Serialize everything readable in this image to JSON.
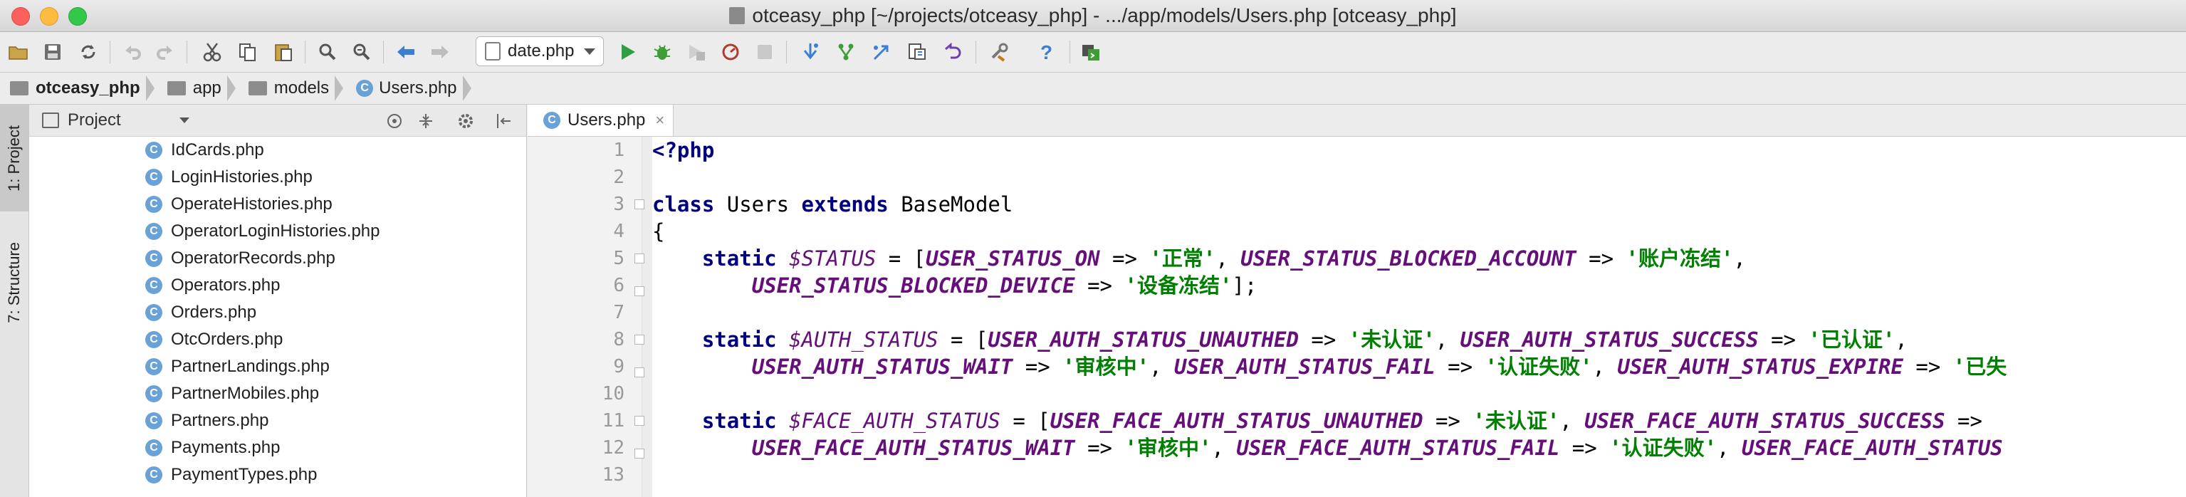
{
  "window": {
    "title": "otceasy_php [~/projects/otceasy_php] - .../app/models/Users.php [otceasy_php]"
  },
  "toolbar": {
    "run_config": "date.php",
    "icons": [
      "open-folder-icon",
      "save-icon",
      "sync-icon",
      "undo-icon",
      "redo-icon",
      "cut-icon",
      "copy-icon",
      "paste-icon",
      "find-icon",
      "replace-icon",
      "back-icon",
      "forward-icon",
      "run-icon",
      "debug-icon",
      "coverage-icon",
      "profile-icon",
      "stop-icon",
      "vcs-update-icon",
      "vcs-commit-icon",
      "vcs-push-icon",
      "vcs-history-icon",
      "vcs-revert-icon",
      "settings-icon",
      "help-icon",
      "terminal-icon"
    ]
  },
  "breadcrumb": [
    {
      "label": "otceasy_php",
      "type": "folder"
    },
    {
      "label": "app",
      "type": "folder"
    },
    {
      "label": "models",
      "type": "folder"
    },
    {
      "label": "Users.php",
      "type": "class"
    }
  ],
  "side_tabs": {
    "project": "1: Project",
    "structure": "7: Structure"
  },
  "project_panel": {
    "title": "Project",
    "files": [
      "IdCards.php",
      "LoginHistories.php",
      "OperateHistories.php",
      "OperatorLoginHistories.php",
      "OperatorRecords.php",
      "Operators.php",
      "Orders.php",
      "OtcOrders.php",
      "PartnerLandings.php",
      "PartnerMobiles.php",
      "Partners.php",
      "Payments.php",
      "PaymentTypes.php"
    ]
  },
  "editor": {
    "tab": "Users.php",
    "line_numbers": [
      "1",
      "2",
      "3",
      "4",
      "5",
      "6",
      "7",
      "8",
      "9",
      "10",
      "11",
      "12",
      "13"
    ],
    "lines": [
      [
        {
          "t": "php",
          "v": "<?php"
        }
      ],
      [],
      [
        {
          "t": "kw",
          "v": "class "
        },
        {
          "t": "p",
          "v": "Users "
        },
        {
          "t": "kw",
          "v": "extends "
        },
        {
          "t": "p",
          "v": "BaseModel"
        }
      ],
      [
        {
          "t": "p",
          "v": "{"
        }
      ],
      [
        {
          "t": "p",
          "v": "    "
        },
        {
          "t": "kw",
          "v": "static "
        },
        {
          "t": "var",
          "v": "$STATUS"
        },
        {
          "t": "p",
          "v": " = ["
        },
        {
          "t": "const",
          "v": "USER_STATUS_ON"
        },
        {
          "t": "p",
          "v": " => "
        },
        {
          "t": "str",
          "v": "'正常'"
        },
        {
          "t": "p",
          "v": ", "
        },
        {
          "t": "const",
          "v": "USER_STATUS_BLOCKED_ACCOUNT"
        },
        {
          "t": "p",
          "v": " => "
        },
        {
          "t": "str",
          "v": "'账户冻结'"
        },
        {
          "t": "p",
          "v": ","
        }
      ],
      [
        {
          "t": "p",
          "v": "        "
        },
        {
          "t": "const",
          "v": "USER_STATUS_BLOCKED_DEVICE"
        },
        {
          "t": "p",
          "v": " => "
        },
        {
          "t": "str",
          "v": "'设备冻结'"
        },
        {
          "t": "p",
          "v": "];"
        }
      ],
      [],
      [
        {
          "t": "p",
          "v": "    "
        },
        {
          "t": "kw",
          "v": "static "
        },
        {
          "t": "var",
          "v": "$AUTH_STATUS"
        },
        {
          "t": "p",
          "v": " = ["
        },
        {
          "t": "const",
          "v": "USER_AUTH_STATUS_UNAUTHED"
        },
        {
          "t": "p",
          "v": " => "
        },
        {
          "t": "str",
          "v": "'未认证'"
        },
        {
          "t": "p",
          "v": ", "
        },
        {
          "t": "const",
          "v": "USER_AUTH_STATUS_SUCCESS"
        },
        {
          "t": "p",
          "v": " => "
        },
        {
          "t": "str",
          "v": "'已认证'"
        },
        {
          "t": "p",
          "v": ","
        }
      ],
      [
        {
          "t": "p",
          "v": "        "
        },
        {
          "t": "const",
          "v": "USER_AUTH_STATUS_WAIT"
        },
        {
          "t": "p",
          "v": " => "
        },
        {
          "t": "str",
          "v": "'审核中'"
        },
        {
          "t": "p",
          "v": ", "
        },
        {
          "t": "const",
          "v": "USER_AUTH_STATUS_FAIL"
        },
        {
          "t": "p",
          "v": " => "
        },
        {
          "t": "str",
          "v": "'认证失败'"
        },
        {
          "t": "p",
          "v": ", "
        },
        {
          "t": "const",
          "v": "USER_AUTH_STATUS_EXPIRE"
        },
        {
          "t": "p",
          "v": " => "
        },
        {
          "t": "str",
          "v": "'已失"
        }
      ],
      [],
      [
        {
          "t": "p",
          "v": "    "
        },
        {
          "t": "kw",
          "v": "static "
        },
        {
          "t": "var",
          "v": "$FACE_AUTH_STATUS"
        },
        {
          "t": "p",
          "v": " = ["
        },
        {
          "t": "const",
          "v": "USER_FACE_AUTH_STATUS_UNAUTHED"
        },
        {
          "t": "p",
          "v": " => "
        },
        {
          "t": "str",
          "v": "'未认证'"
        },
        {
          "t": "p",
          "v": ", "
        },
        {
          "t": "const",
          "v": "USER_FACE_AUTH_STATUS_SUCCESS"
        },
        {
          "t": "p",
          "v": " =>"
        }
      ],
      [
        {
          "t": "p",
          "v": "        "
        },
        {
          "t": "const",
          "v": "USER_FACE_AUTH_STATUS_WAIT"
        },
        {
          "t": "p",
          "v": " => "
        },
        {
          "t": "str",
          "v": "'审核中'"
        },
        {
          "t": "p",
          "v": ", "
        },
        {
          "t": "const",
          "v": "USER_FACE_AUTH_STATUS_FAIL"
        },
        {
          "t": "p",
          "v": " => "
        },
        {
          "t": "str",
          "v": "'认证失败'"
        },
        {
          "t": "p",
          "v": ", "
        },
        {
          "t": "const",
          "v": "USER_FACE_AUTH_STATUS"
        }
      ],
      []
    ]
  }
}
